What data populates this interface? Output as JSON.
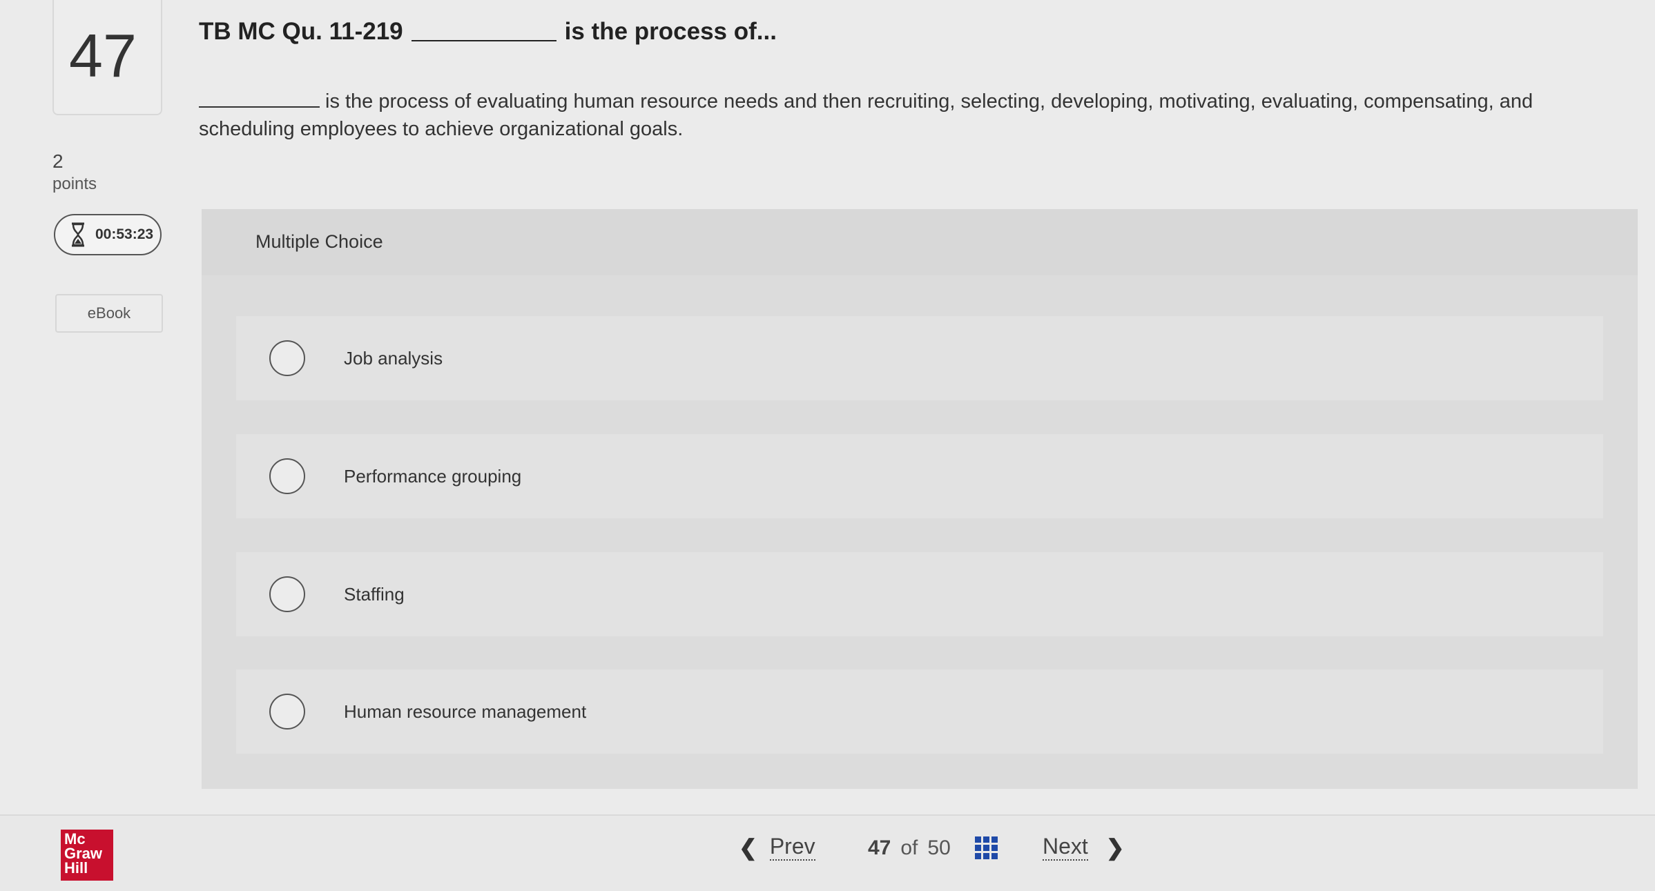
{
  "question": {
    "number": "47",
    "points_value": "2",
    "points_label": "points",
    "header_prefix": "TB MC Qu. 11-219",
    "header_suffix": "is the process of...",
    "body_text": "is the process of evaluating human resource needs and then recruiting, selecting, developing, motivating, evaluating, compensating, and scheduling employees to achieve organizational goals."
  },
  "timer": {
    "value": "00:53:23",
    "icon": "hourglass-icon"
  },
  "ebook": {
    "label": "eBook"
  },
  "multiple_choice": {
    "title": "Multiple Choice",
    "options": [
      {
        "label": "Job analysis"
      },
      {
        "label": "Performance grouping"
      },
      {
        "label": "Staffing"
      },
      {
        "label": "Human resource management"
      }
    ]
  },
  "footer": {
    "logo_lines": [
      "Mc",
      "Graw",
      "Hill"
    ],
    "logo_color": "#c8102e",
    "prev_label": "Prev",
    "current_page": "47",
    "of_label": "of",
    "total_pages": "50",
    "next_label": "Next",
    "grid_icon": "grid-icon",
    "grid_icon_color": "#1f4aa8"
  }
}
